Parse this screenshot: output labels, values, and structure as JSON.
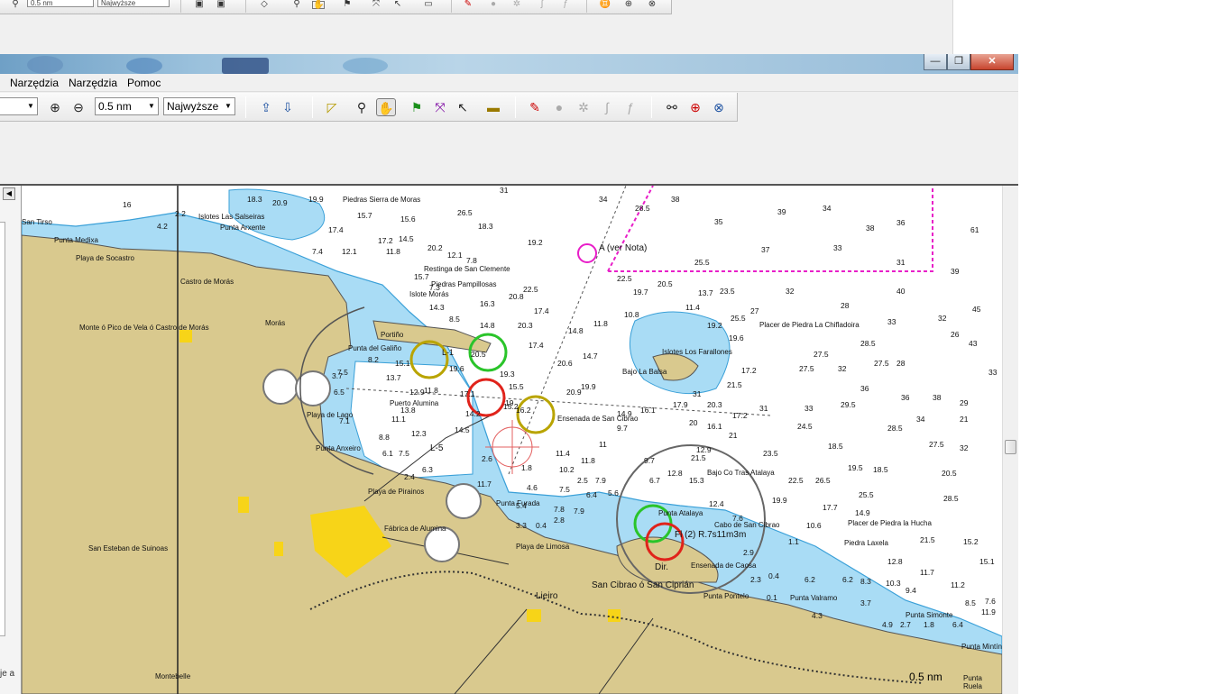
{
  "background_window": {
    "scale_value": "0.5 nm",
    "detail_value": "Najwyższe"
  },
  "window": {
    "minimize_label": "—",
    "restore_label": "❐",
    "close_label": "✕"
  },
  "menu": [
    {
      "label": "Narzędzia"
    },
    {
      "label": "Narzędzia"
    },
    {
      "label": "Pomoc"
    }
  ],
  "toolbar": {
    "scale_combo_value": "0.5 nm",
    "detail_combo_value": "Najwyższe"
  },
  "left_panel": {
    "fragment_text": "je a"
  },
  "colors": {
    "land": "#d9c98e",
    "shallow_water": "#a9dcf5",
    "deep_water": "#ffffff",
    "contour": "#3aa0d8",
    "industrial": "#f7d418",
    "limit_line": "#e81ec8"
  },
  "map": {
    "place_labels": [
      "San Tirso",
      "Punta Medixa",
      "Playa de Socastro",
      "Islotes Las Salseiras",
      "Punta Arxente",
      "Piedras Sierra de Moras",
      "Restinga de San Clemente",
      "Piedras Pampillosas",
      "Islote Morás",
      "Castro de Morás",
      "Monte ó Pico de Vela ó Castro de Morás",
      "Morás",
      "Punta del Galiño",
      "Portiño",
      "Playa de Lago",
      "Puerto Alumina",
      "Punta Anxeiro",
      "Ensenada de San Cibrao",
      "Playa de Pirainos",
      "Fábrica de Alumina",
      "Punta Furada",
      "Playa de Limosa",
      "Lieiro",
      "San Esteban de Suinoas",
      "San Cibrao ó San Ciprián",
      "Punta Atalaya",
      "Cabo de San Cibrao",
      "Ensenada de Caosa",
      "Punta Pontelo",
      "Punta Valramo",
      "Islotes Los Farallones",
      "Bajo La Balsa",
      "Bajo Co Tras Atalaya",
      "Placer de Piedra La Chifladoira",
      "Placer de Piedra la Hucha",
      "Piedra Laxela",
      "Punta Simonte",
      "Punta Mintín",
      "Punta Ruela",
      "Montebelle"
    ],
    "light_labels": [
      "A (ver Nota)",
      "L-1",
      "L-5",
      "Fl (2) R.7s11m3m",
      "Dir."
    ],
    "scale_bar_label": "0.5 nm"
  }
}
